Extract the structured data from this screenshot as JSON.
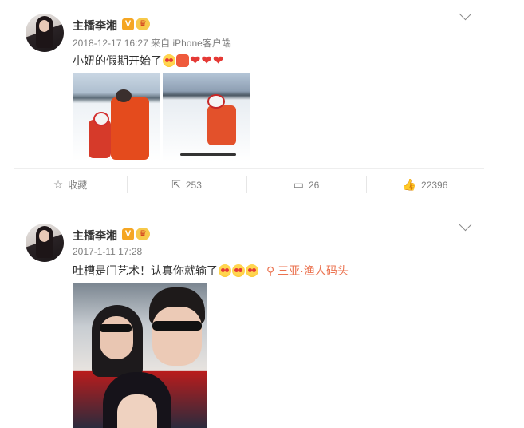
{
  "posts": [
    {
      "username": "主播李湘",
      "badge_verified": "V",
      "badge_crown": "♛",
      "timestamp": "2018-12-17 16:27",
      "source_prefix": "来自",
      "source_client": "iPhone客户端",
      "text": "小妞的假期开始了",
      "emoji": [
        "heart-eyes-emoji",
        "muscle-emoji",
        "heart-emoji",
        "heart-emoji",
        "heart-emoji"
      ],
      "images": [
        "ski-photo-1",
        "ski-photo-2"
      ],
      "actions": {
        "favorite_label": "收藏",
        "repost_count": "253",
        "comment_count": "26",
        "like_count": "22396"
      }
    },
    {
      "username": "主播李湘",
      "badge_verified": "V",
      "badge_crown": "♛",
      "timestamp": "2017-1-11 17:28",
      "text": "吐槽是门艺术！认真你就输了",
      "emoji": [
        "heart-face-emoji",
        "heart-face-emoji",
        "heart-face-emoji"
      ],
      "location_icon": "location-pin-icon",
      "location": "三亚·渔人码头",
      "images": [
        "yacht-selfie-photo"
      ]
    }
  ]
}
